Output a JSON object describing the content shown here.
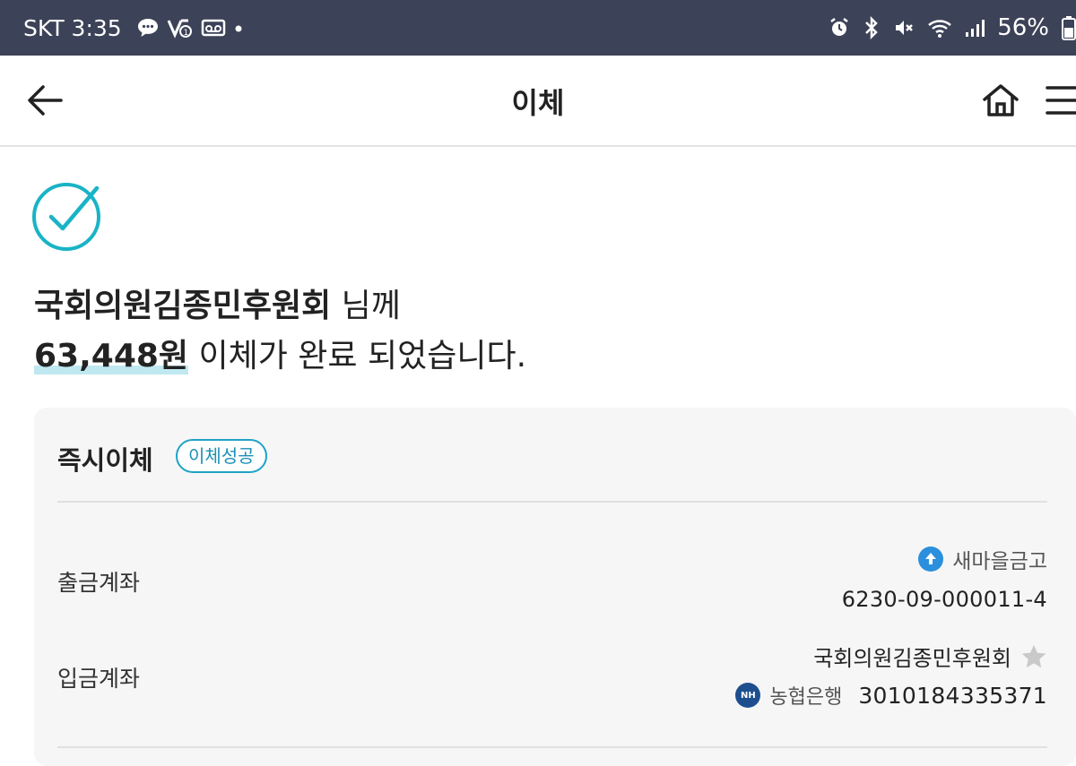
{
  "status_bar": {
    "carrier": "SKT",
    "time": "3:35",
    "battery": "56%",
    "background": "#3c4257",
    "icons_left": [
      "chat-icon",
      "network-speed-icon",
      "voicemail-icon",
      "dot-icon"
    ],
    "icons_right": [
      "alarm-icon",
      "bluetooth-icon",
      "mute-icon",
      "wifi-icon",
      "signal-icon",
      "battery-icon"
    ]
  },
  "header": {
    "title": "이체"
  },
  "result": {
    "recipient_name": "국회의원김종민후원회",
    "honorific": " 님께",
    "amount": "63,448원",
    "message": " 이체가 완료 되었습니다.",
    "accent_color": "#1ab3c6"
  },
  "card": {
    "title": "즉시이체",
    "badge": "이체성공",
    "from": {
      "label": "출금계좌",
      "bank": "새마을금고",
      "account": "6230-09-000011-4"
    },
    "to": {
      "label": "입금계좌",
      "name": "국회의원김종민후원회",
      "bank": "농협은행",
      "bank_logo_text": "NH",
      "account": "3010184335371"
    }
  }
}
